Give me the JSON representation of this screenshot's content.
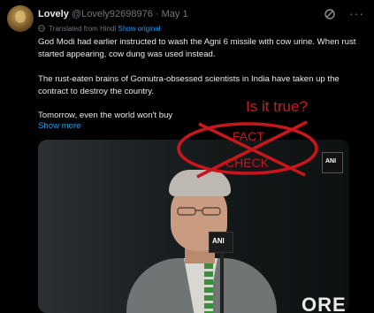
{
  "tweet": {
    "name": "Lovely",
    "handle": "@Lovely92698976",
    "separator": "·",
    "date": "May 1",
    "translated_label": "Translated from Hindi",
    "show_original": "Show original",
    "paragraph1": "God Modi had earlier instructed to wash the Agni 6 missile with cow urine. When rust started appearing, cow dung was used instead.",
    "paragraph2": "The rust-eaten brains of Gomutra-obsessed scientists in India have taken up the contract to destroy the country.",
    "paragraph3": "Tomorrow, even the world won't buy",
    "show_more": "Show more",
    "more_icon": "···"
  },
  "media": {
    "mic_logo": "ANI",
    "corner_logo": "ANI",
    "bottom_text": "ORE"
  },
  "overlay": {
    "question": "Is it true?",
    "fact": "FACT",
    "check": "CHECK",
    "color": "#d6151b"
  },
  "colors": {
    "background": "#000000",
    "text": "#e7e9ea",
    "muted": "#71767b",
    "link": "#1d9bf0"
  }
}
